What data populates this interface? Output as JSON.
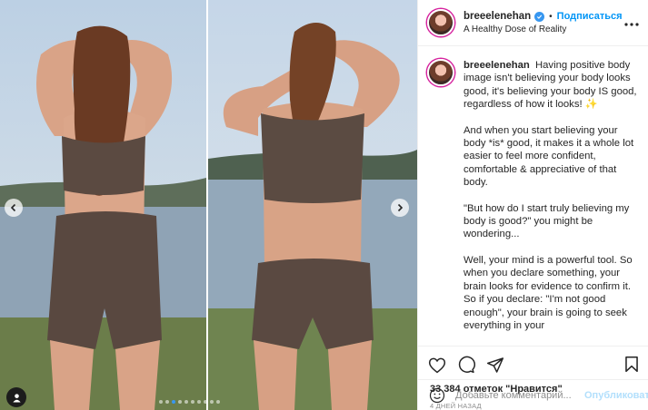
{
  "post": {
    "username": "breeelenehan",
    "follow_label": "Подписаться",
    "separator": "•",
    "location": "A Healthy Dose of Reality",
    "more_icon": "more-dots-icon",
    "caption_paragraphs": [
      "Having positive body image isn't believing your body looks good, it's believing your body IS good, regardless of how it looks! ✨",
      "And when you start believing your body *is* good, it makes it a whole lot easier to feel more confident, comfortable & appreciative of that body.",
      "\"But how do I start truly believing my body is good?\" you might be wondering...",
      "Well, your mind is a powerful tool. So when you declare something, your brain looks for evidence to confirm it. So if you declare: \"I'm not good enough\", your brain is going to seek everything in your"
    ],
    "likes": "33 384 отметок \"Нравится\"",
    "time_ago": "4 ДНЕЙ НАЗАД",
    "comment_placeholder": "Добавьте комментарий...",
    "publish_label": "Опубликовать",
    "carousel": {
      "total_slides": 10,
      "active_slide": 3
    },
    "colors": {
      "accent": "#0095f6",
      "verified": "#3897f0",
      "publish_disabled": "#b2dffc"
    }
  }
}
